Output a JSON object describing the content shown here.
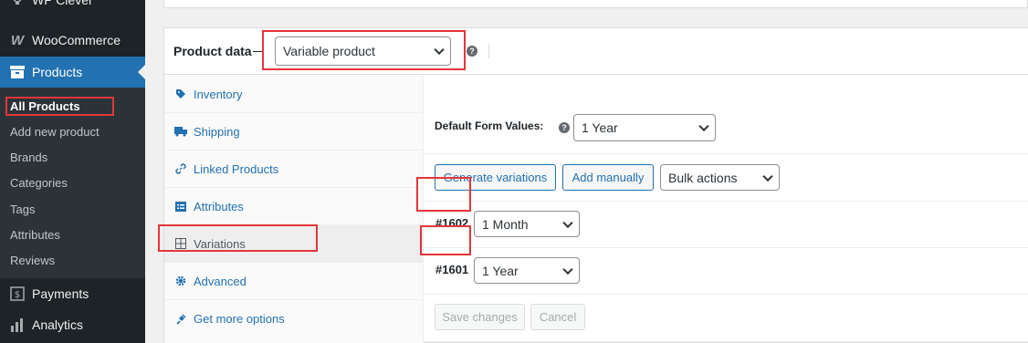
{
  "sidebar": {
    "menu": [
      {
        "label": "WP Clever",
        "icon": "bulb-icon"
      },
      {
        "label": "WooCommerce",
        "icon": "woocommerce-icon"
      },
      {
        "label": "Products",
        "icon": "archive-box-icon",
        "current": true
      },
      {
        "label": "Payments",
        "icon": "payments-icon"
      },
      {
        "label": "Analytics",
        "icon": "bar-chart-icon"
      }
    ],
    "submenu": [
      {
        "label": "All Products",
        "current": true
      },
      {
        "label": "Add new product"
      },
      {
        "label": "Brands"
      },
      {
        "label": "Categories"
      },
      {
        "label": "Tags"
      },
      {
        "label": "Attributes"
      },
      {
        "label": "Reviews"
      }
    ]
  },
  "product_data": {
    "title": "Product data",
    "type_select": "Variable product",
    "help": "?",
    "tabs": [
      {
        "label": "Inventory",
        "icon": "tag-icon"
      },
      {
        "label": "Shipping",
        "icon": "truck-icon"
      },
      {
        "label": "Linked Products",
        "icon": "link-icon"
      },
      {
        "label": "Attributes",
        "icon": "list-icon"
      },
      {
        "label": "Variations",
        "icon": "grid-icon",
        "active": true
      },
      {
        "label": "Advanced",
        "icon": "gear-icon"
      },
      {
        "label": "Get more options",
        "icon": "plugin-icon"
      }
    ],
    "variations": {
      "default_form_label": "Default Form Values:",
      "default_form_value": "1 Year",
      "generate_btn": "Generate variations",
      "add_manually_btn": "Add manually",
      "bulk_actions": "Bulk actions",
      "items": [
        {
          "id": "#1602",
          "value": "1 Month"
        },
        {
          "id": "#1601",
          "value": "1 Year"
        }
      ],
      "save_btn": "Save changes",
      "cancel_btn": "Cancel"
    }
  },
  "colors": {
    "sidebar_bg": "#1d2327",
    "accent": "#2271b1",
    "highlight": "#e3363b"
  }
}
